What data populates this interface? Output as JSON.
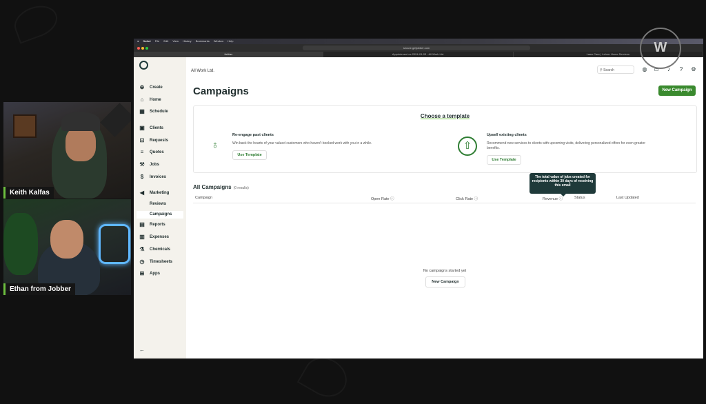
{
  "participants": [
    {
      "name": "Keith Kalfas"
    },
    {
      "name": "Ethan from Jobber"
    }
  ],
  "macos": {
    "app": "Safari",
    "menus": [
      "File",
      "Edit",
      "View",
      "History",
      "Bookmarks",
      "Window",
      "Help"
    ]
  },
  "browser": {
    "url": "secure.getjobber.com",
    "tabs": [
      "Jobber",
      "Appointment ex 2024-01-03 - All Work Ltd.",
      "Lawn Care | Lehrer Home Services"
    ]
  },
  "app": {
    "account": "All Work Ltd.",
    "search_label": "Search",
    "sidebar": {
      "create": "Create",
      "home": "Home",
      "schedule": "Schedule",
      "clients": "Clients",
      "requests": "Requests",
      "quotes": "Quotes",
      "jobs": "Jobs",
      "invoices": "Invoices",
      "marketing": "Marketing",
      "reviews": "Reviews",
      "campaigns": "Campaigns",
      "reports": "Reports",
      "expenses": "Expenses",
      "chemicals": "Chemicals",
      "timesheets": "Timesheets",
      "apps": "Apps"
    },
    "page_title": "Campaigns",
    "new_campaign": "New Campaign",
    "templates": {
      "heading": "Choose a template",
      "items": [
        {
          "title": "Re-engage past clients",
          "desc": "Win back the hearts of your valued customers who haven't booked work with you in a while.",
          "button": "Use Template"
        },
        {
          "title": "Upsell existing clients",
          "desc": "Recommend new services to clients with upcoming visits, delivering personalized offers for even greater benefits.",
          "button": "Use Template"
        }
      ]
    },
    "list": {
      "title": "All Campaigns",
      "count": "(0 results)",
      "columns": [
        "Campaign",
        "Open Rate",
        "Click Rate",
        "Revenue",
        "Status",
        "Last Updated"
      ],
      "tooltip": "The total value of jobs created for recipients within 30 days of receiving this email",
      "empty": "No campaigns started yet",
      "empty_button": "New Campaign"
    }
  },
  "colors": {
    "brand_green": "#3a8a2e",
    "sidebar_bg": "#f4f2ec",
    "tooltip_bg": "#1f3a3a"
  }
}
